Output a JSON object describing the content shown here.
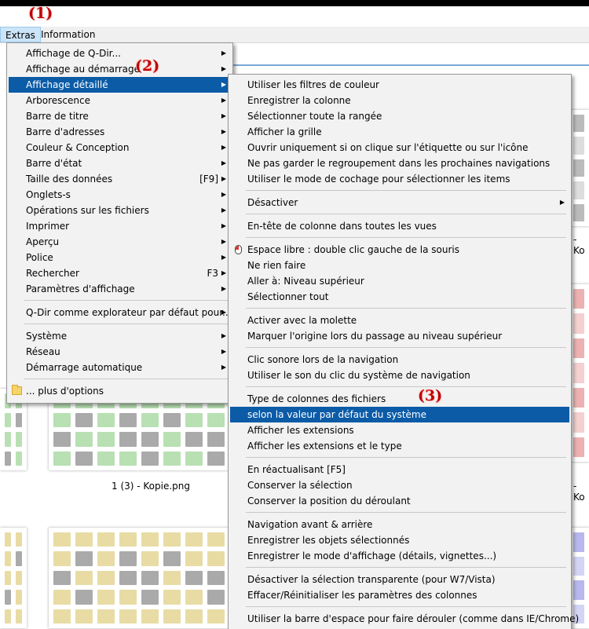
{
  "colors": {
    "accent": "#0b5ba7",
    "callout": "#c00000"
  },
  "callouts": {
    "c1": "(1)",
    "c2": "(2)",
    "c3": "(3)"
  },
  "menubar": {
    "extras": "Extras",
    "information": "Information"
  },
  "background": {
    "captions": {
      "middle": "1 (3) - Kopie.png",
      "right_top": "- Ko",
      "right_mid": "- Ko"
    }
  },
  "extras_menu": {
    "items": [
      {
        "label": "Affichage de Q-Dir...",
        "submenu": true
      },
      {
        "label": "Affichage au démarrage",
        "submenu": true
      },
      {
        "label": "Affichage détaillé",
        "submenu": true,
        "highlighted": true
      },
      {
        "label": "Arborescence",
        "submenu": true
      },
      {
        "label": "Barre de titre",
        "submenu": true
      },
      {
        "label": "Barre d'adresses",
        "submenu": true
      },
      {
        "label": "Couleur & Conception",
        "submenu": true
      },
      {
        "label": "Barre d'état",
        "submenu": true
      },
      {
        "label": "Taille des données",
        "shortcut": "[F9]",
        "submenu": true
      },
      {
        "label": "Onglets-s",
        "submenu": true
      },
      {
        "label": "Opérations sur les fichiers",
        "submenu": true
      },
      {
        "label": "Imprimer",
        "submenu": true
      },
      {
        "label": "Aperçu",
        "submenu": true
      },
      {
        "label": "Police",
        "submenu": true
      },
      {
        "label": "Rechercher",
        "shortcut": "F3",
        "submenu": true
      },
      {
        "label": "Paramètres d'affichage",
        "submenu": true
      },
      {
        "label": "Q-Dir comme explorateur par défaut pour...",
        "submenu": true
      },
      {
        "label": "Système",
        "submenu": true
      },
      {
        "label": "Réseau",
        "submenu": true
      },
      {
        "label": "Démarrage automatique",
        "submenu": true
      },
      {
        "label": "... plus d'options",
        "icon": "folder-icon"
      }
    ]
  },
  "detail_menu": {
    "items": [
      {
        "label": "Utiliser les filtres de couleur"
      },
      {
        "label": "Enregistrer la colonne"
      },
      {
        "label": "Sélectionner toute la rangée"
      },
      {
        "label": "Afficher la grille"
      },
      {
        "label": "Ouvrir uniquement si on clique sur l'étiquette ou sur l'icône"
      },
      {
        "label": "Ne pas garder le regroupement dans les prochaines navigations"
      },
      {
        "label": "Utiliser le mode de cochage pour sélectionner les items"
      },
      {
        "label": "Désactiver",
        "submenu": true
      },
      {
        "label": "En-tête de colonne dans toutes les vues"
      },
      {
        "label": "Espace libre : double clic gauche de la souris",
        "icon": "mouse-icon"
      },
      {
        "label": "Ne rien faire"
      },
      {
        "label": "Aller à: Niveau supérieur"
      },
      {
        "label": "Sélectionner tout"
      },
      {
        "label": "Activer avec la molette"
      },
      {
        "label": "Marquer l'origine lors du passage au niveau supérieur"
      },
      {
        "label": "Clic sonore lors de la navigation"
      },
      {
        "label": "Utiliser le son du clic du système de navigation"
      },
      {
        "label": "Type de colonnes des fichiers"
      },
      {
        "label": "selon la valeur par défaut du système",
        "highlighted": true
      },
      {
        "label": "Afficher les extensions"
      },
      {
        "label": "Afficher les extensions et le type"
      },
      {
        "label": "En réactualisant [F5]"
      },
      {
        "label": "Conserver la sélection"
      },
      {
        "label": "Conserver la position du déroulant"
      },
      {
        "label": "Navigation avant & arrière"
      },
      {
        "label": "Enregistrer les objets sélectionnés"
      },
      {
        "label": "Enregistrer le mode d'affichage (détails, vignettes...)"
      },
      {
        "label": "Désactiver la sélection transparente (pour W7/Vista)"
      },
      {
        "label": "Effacer/Réinitialiser les paramètres des colonnes"
      },
      {
        "label": "Utiliser la barre d'espace pour faire dérouler (comme dans IE/Chrome)"
      }
    ]
  }
}
